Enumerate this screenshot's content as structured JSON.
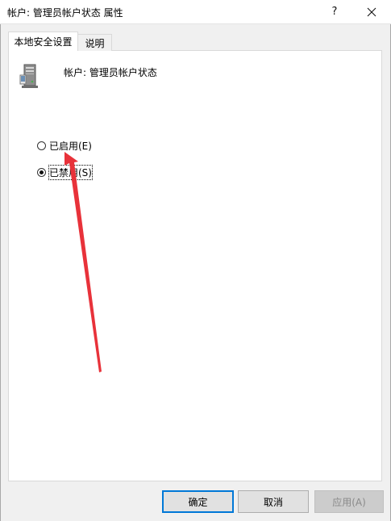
{
  "window": {
    "title": "帐户: 管理员帐户状态 属性",
    "help_label": "?",
    "close_icon": "close-icon"
  },
  "tabs": [
    {
      "label": "本地安全设置",
      "active": true
    },
    {
      "label": "说明",
      "active": false
    }
  ],
  "panel": {
    "icon": "computer-icon",
    "heading": "帐户: 管理员帐户状态",
    "options": [
      {
        "label": "已启用(E)",
        "checked": false
      },
      {
        "label": "已禁用(S)",
        "checked": true
      }
    ]
  },
  "annotation": {
    "arrow_color": "#e8323a"
  },
  "buttons": {
    "ok": "确定",
    "cancel": "取消",
    "apply": "应用(A)"
  }
}
